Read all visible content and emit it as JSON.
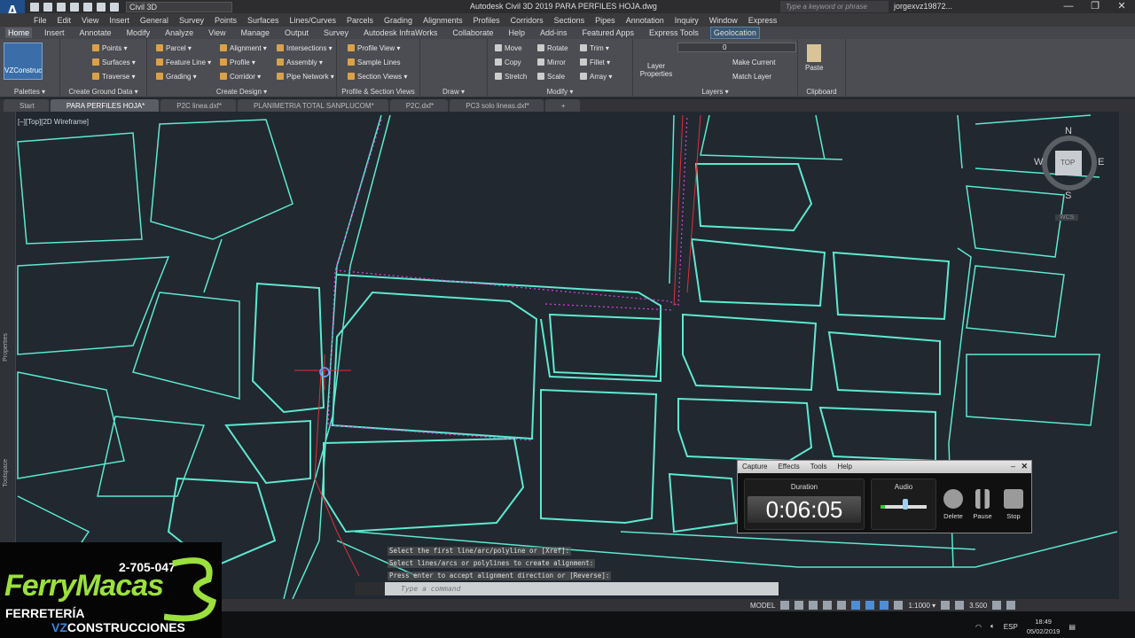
{
  "app": {
    "logo": "A",
    "logo_sub": "C3D",
    "workspace": "Civil 3D",
    "title": "Autodesk Civil 3D 2019   PARA PERFILES HOJA.dwg",
    "search_placeholder": "Type a keyword or phrase",
    "user": "jorgexvz19872...",
    "minimize": "—",
    "restore": "❐",
    "close": "✕"
  },
  "menu": [
    "File",
    "Edit",
    "View",
    "Insert",
    "General",
    "Survey",
    "Points",
    "Surfaces",
    "Lines/Curves",
    "Parcels",
    "Grading",
    "Alignments",
    "Profiles",
    "Corridors",
    "Sections",
    "Pipes",
    "Annotation",
    "Inquiry",
    "Window",
    "Express"
  ],
  "ribbon_tabs": [
    "Home",
    "Insert",
    "Annotate",
    "Modify",
    "Analyze",
    "View",
    "Manage",
    "Output",
    "Survey",
    "Autodesk InfraWorks",
    "Collaborate",
    "Help",
    "Add-ins",
    "Featured Apps",
    "Express Tools",
    "Geolocation"
  ],
  "ribbon": {
    "vz": "VZConstruc",
    "palettes": "Palettes ▾",
    "ground": {
      "label": "Create Ground Data ▾",
      "items": [
        "Points ▾",
        "Surfaces ▾",
        "Traverse ▾"
      ]
    },
    "design": {
      "label": "Create Design ▾",
      "items": [
        "Parcel ▾",
        "Feature Line ▾",
        "Grading ▾",
        "Alignment ▾",
        "Profile ▾",
        "Corridor ▾",
        "Intersections ▾",
        "Assembly ▾",
        "Pipe Network ▾"
      ]
    },
    "psv": {
      "label": "Profile & Section Views",
      "items": [
        "Profile View ▾",
        "Sample Lines",
        "Section Views ▾"
      ]
    },
    "draw": {
      "label": "Draw ▾"
    },
    "modify": {
      "label": "Modify ▾",
      "items": [
        "Move",
        "Copy",
        "Stretch",
        "Rotate",
        "Mirror",
        "Scale",
        "Trim ▾",
        "Fillet ▾",
        "Array ▾"
      ]
    },
    "layers": {
      "label": "Layers ▾",
      "layer_props": "Layer Properties",
      "current_layer": "0",
      "make_current": "Make Current",
      "match_layer": "Match Layer"
    },
    "clipboard": {
      "label": "Clipboard",
      "paste": "Paste"
    }
  },
  "file_tabs": [
    "Start",
    "PARA PERFILES HOJA*",
    "P2C linea.dxf*",
    "PLANIMETRIA TOTAL SANPLUCOM*",
    "P2C.dxf*",
    "PC3 solo lineas.dxf*",
    "+"
  ],
  "viewport": {
    "label": "[–][Top][2D Wireframe]",
    "side_labels": [
      "Properties",
      "Toolspace"
    ]
  },
  "viewcube": {
    "n": "N",
    "s": "S",
    "e": "E",
    "w": "W",
    "top": "TOP",
    "wcs": "WCS"
  },
  "command": {
    "history": [
      "Select the first line/arc/polyline or [Xref]:",
      "Select lines/arcs or polylines to create alignment:",
      "Press enter to accept alignment direction or [Reverse]:"
    ],
    "placeholder": "Type a command"
  },
  "status": {
    "model": "MODEL",
    "scale": "1:1000 ▾",
    "annoscale": "3.500"
  },
  "tray": {
    "lang": "ESP",
    "time": "18:49",
    "date": "05/02/2019"
  },
  "logo_overlay": {
    "phone": "2-705-047",
    "brand": "FerryMacas",
    "line1": "FERRETERÍA",
    "line2a": "VZ",
    "line2b": "CONSTRUCCIONES"
  },
  "capture": {
    "menu": [
      "Capture",
      "Effects",
      "Tools",
      "Help"
    ],
    "duration_label": "Duration",
    "duration": "0:06:05",
    "audio_label": "Audio",
    "audio_level": 0.55,
    "buttons": [
      "Delete",
      "Pause",
      "Stop"
    ],
    "min": "–",
    "close": "✕"
  },
  "colors": {
    "linework": "#5ee8cf",
    "alignment": "#e040e0",
    "redline": "#e0303a",
    "background": "#212830"
  }
}
